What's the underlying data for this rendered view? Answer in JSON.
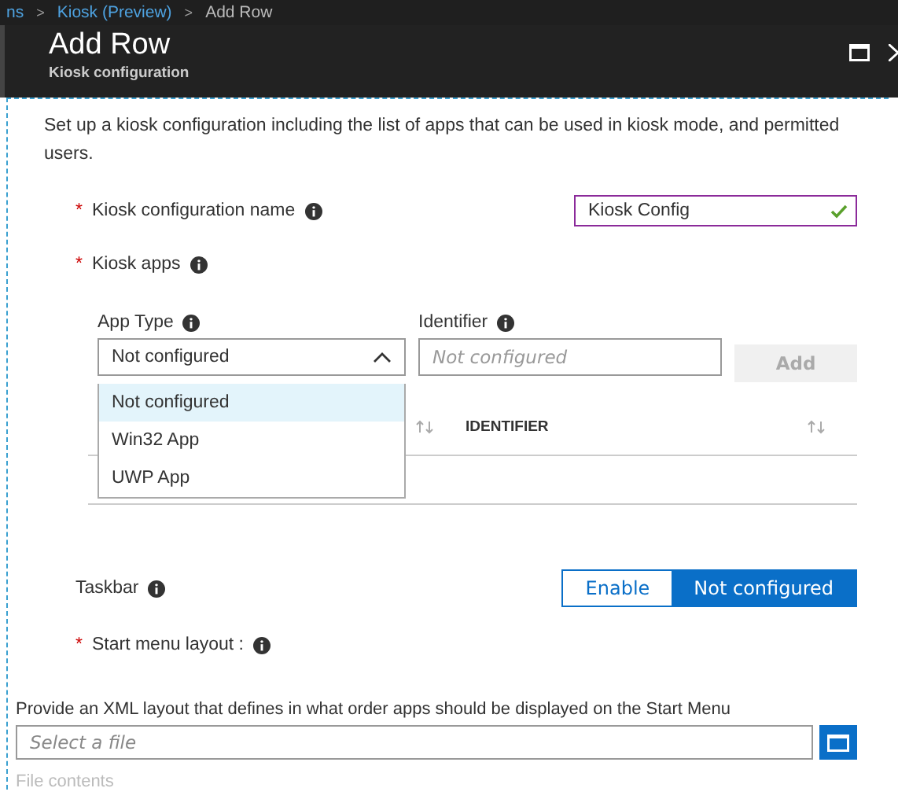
{
  "breadcrumb": [
    {
      "kind": "link",
      "label": "ns"
    },
    {
      "kind": "separator",
      "label": ">"
    },
    {
      "kind": "link",
      "label": "Kiosk (Preview)"
    },
    {
      "kind": "separator",
      "label": ">"
    },
    {
      "kind": "current",
      "label": "Add Row"
    }
  ],
  "header": {
    "title": "Add Row",
    "subtitle": "Kiosk configuration"
  },
  "description": "Set up a kiosk configuration including the list of apps that can be used in kiosk mode, and permitted users.",
  "name_field": {
    "label": "Kiosk configuration name",
    "required_mark": "*",
    "value": "Kiosk Config",
    "valid": true
  },
  "kiosk_apps": {
    "label": "Kiosk apps",
    "required_mark": "*",
    "app_type": {
      "label": "App Type",
      "value": "Not configured",
      "expanded": true,
      "options": [
        {
          "label": "Not configured",
          "selected": true
        },
        {
          "label": "Win32 App",
          "selected": false
        },
        {
          "label": "UWP App",
          "selected": false
        }
      ]
    },
    "identifier": {
      "label": "Identifier",
      "placeholder": "Not configured"
    },
    "add_button": {
      "label": "Add",
      "disabled": true
    },
    "table": {
      "columns": [
        "IDENTIFIER"
      ]
    }
  },
  "taskbar": {
    "label": "Taskbar",
    "options": [
      {
        "label": "Enable",
        "selected": false
      },
      {
        "label": "Not configured",
        "selected": true
      }
    ]
  },
  "start_menu": {
    "label": "Start menu layout :",
    "required_mark": "*",
    "hint": "Provide an XML layout that defines in what order apps should be displayed on the Start Menu",
    "file_field": {
      "placeholder": "Select a file"
    }
  },
  "file_contents": {
    "label": "File contents"
  }
}
